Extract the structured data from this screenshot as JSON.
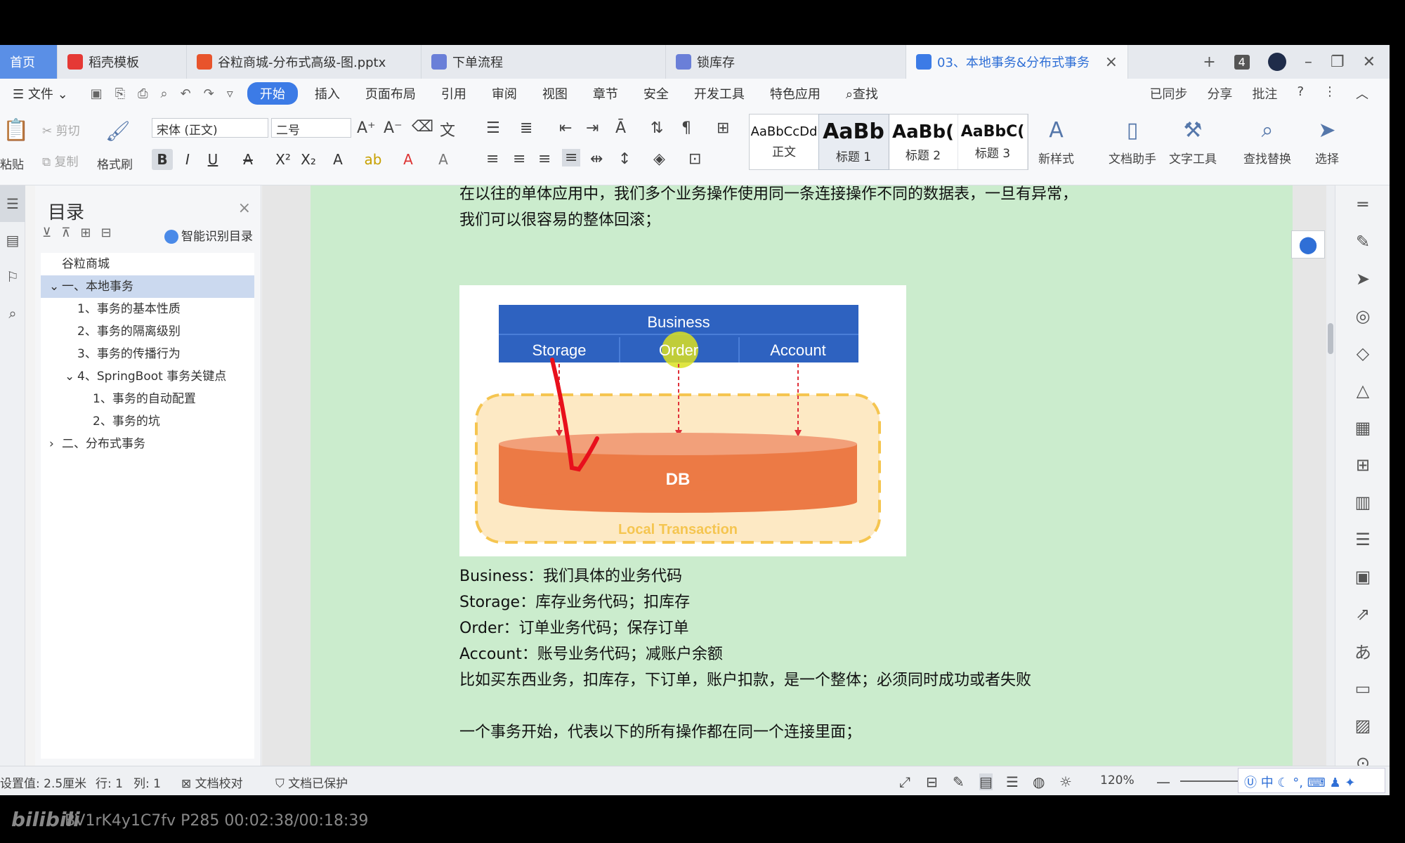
{
  "tabs": [
    {
      "label": "首页",
      "kind": "home"
    },
    {
      "label": "稻壳模板",
      "kind": "doke"
    },
    {
      "label": "谷粒商城-分布式高级-图.pptx",
      "kind": "ppt"
    },
    {
      "label": "下单流程",
      "kind": "flow"
    },
    {
      "label": "锁库存",
      "kind": "flow"
    },
    {
      "label": "03、本地事务&分布式事务",
      "kind": "doc"
    }
  ],
  "tabbar_right": {
    "add": "+",
    "count": "4"
  },
  "menu": {
    "file": "文件",
    "items": [
      "开始",
      "插入",
      "页面布局",
      "引用",
      "审阅",
      "视图",
      "章节",
      "安全",
      "开发工具",
      "特色应用",
      "查找"
    ],
    "active": "开始",
    "right": [
      "已同步",
      "分享",
      "批注",
      "?"
    ]
  },
  "ribbon": {
    "paste": "粘贴",
    "cut": "剪切",
    "copy": "复制",
    "format_painter": "格式刷",
    "font_name": "宋体 (正文)",
    "font_size": "二号",
    "styles": [
      {
        "preview": "AaBbCcDd",
        "name": "正文"
      },
      {
        "preview": "AaBb",
        "name": "标题 1"
      },
      {
        "preview": "AaBb(",
        "name": "标题 2"
      },
      {
        "preview": "AaBbC(",
        "name": "标题 3"
      }
    ],
    "tools": [
      "新样式",
      "文档助手",
      "文字工具",
      "查找替换",
      "选择"
    ]
  },
  "toc": {
    "title": "目录",
    "smart": "智能识别目录",
    "items": [
      {
        "text": "谷粒商城",
        "indent": 0,
        "active": false,
        "toggle": ""
      },
      {
        "text": "一、本地事务",
        "indent": 0,
        "active": true,
        "toggle": "⌄"
      },
      {
        "text": "1、事务的基本性质",
        "indent": 1,
        "active": false,
        "toggle": ""
      },
      {
        "text": "2、事务的隔离级别",
        "indent": 1,
        "active": false,
        "toggle": ""
      },
      {
        "text": "3、事务的传播行为",
        "indent": 1,
        "active": false,
        "toggle": ""
      },
      {
        "text": "4、SpringBoot 事务关键点",
        "indent": 1,
        "active": false,
        "toggle": "⌄"
      },
      {
        "text": "1、事务的自动配置",
        "indent": 2,
        "active": false,
        "toggle": ""
      },
      {
        "text": "2、事务的坑",
        "indent": 2,
        "active": false,
        "toggle": ""
      },
      {
        "text": "二、分布式事务",
        "indent": 0,
        "active": false,
        "toggle": "›"
      }
    ]
  },
  "document": {
    "intro_line1": "在以往的单体应用中，我们多个业务操作使用同一条连接操作不同的数据表，一旦有异常，",
    "intro_line2": "我们可以很容易的整体回滚；",
    "diagram": {
      "business": "Business",
      "storage": "Storage",
      "order": "Order",
      "account": "Account",
      "db": "DB",
      "local_tx": "Local Transaction"
    },
    "lines": [
      "Business：我们具体的业务代码",
      "Storage：库存业务代码；扣库存",
      "Order：订单业务代码；保存订单",
      "Account：账号业务代码；减账户余额",
      "比如买东西业务，扣库存，下订单，账户扣款，是一个整体；必须同时成功或者失败",
      "",
      "一个事务开始，代表以下的所有操作都在同一个连接里面；"
    ]
  },
  "status": {
    "setting": "设置值: 2.5厘米",
    "row": "行: 1",
    "col": "列: 1",
    "proof": "文档校对",
    "protected": "文档已保护",
    "zoom": "120%"
  },
  "footer": {
    "logo": "bilibili",
    "video": "BV1rK4y1C7fv P285 00:02:38/00:18:39"
  },
  "colors": {
    "accent": "#3c7be6",
    "page_bg": "#cbeccd",
    "diagram_blue": "#2e62c0",
    "db_orange": "#ec7a45",
    "tx_dash": "#f5c550"
  }
}
